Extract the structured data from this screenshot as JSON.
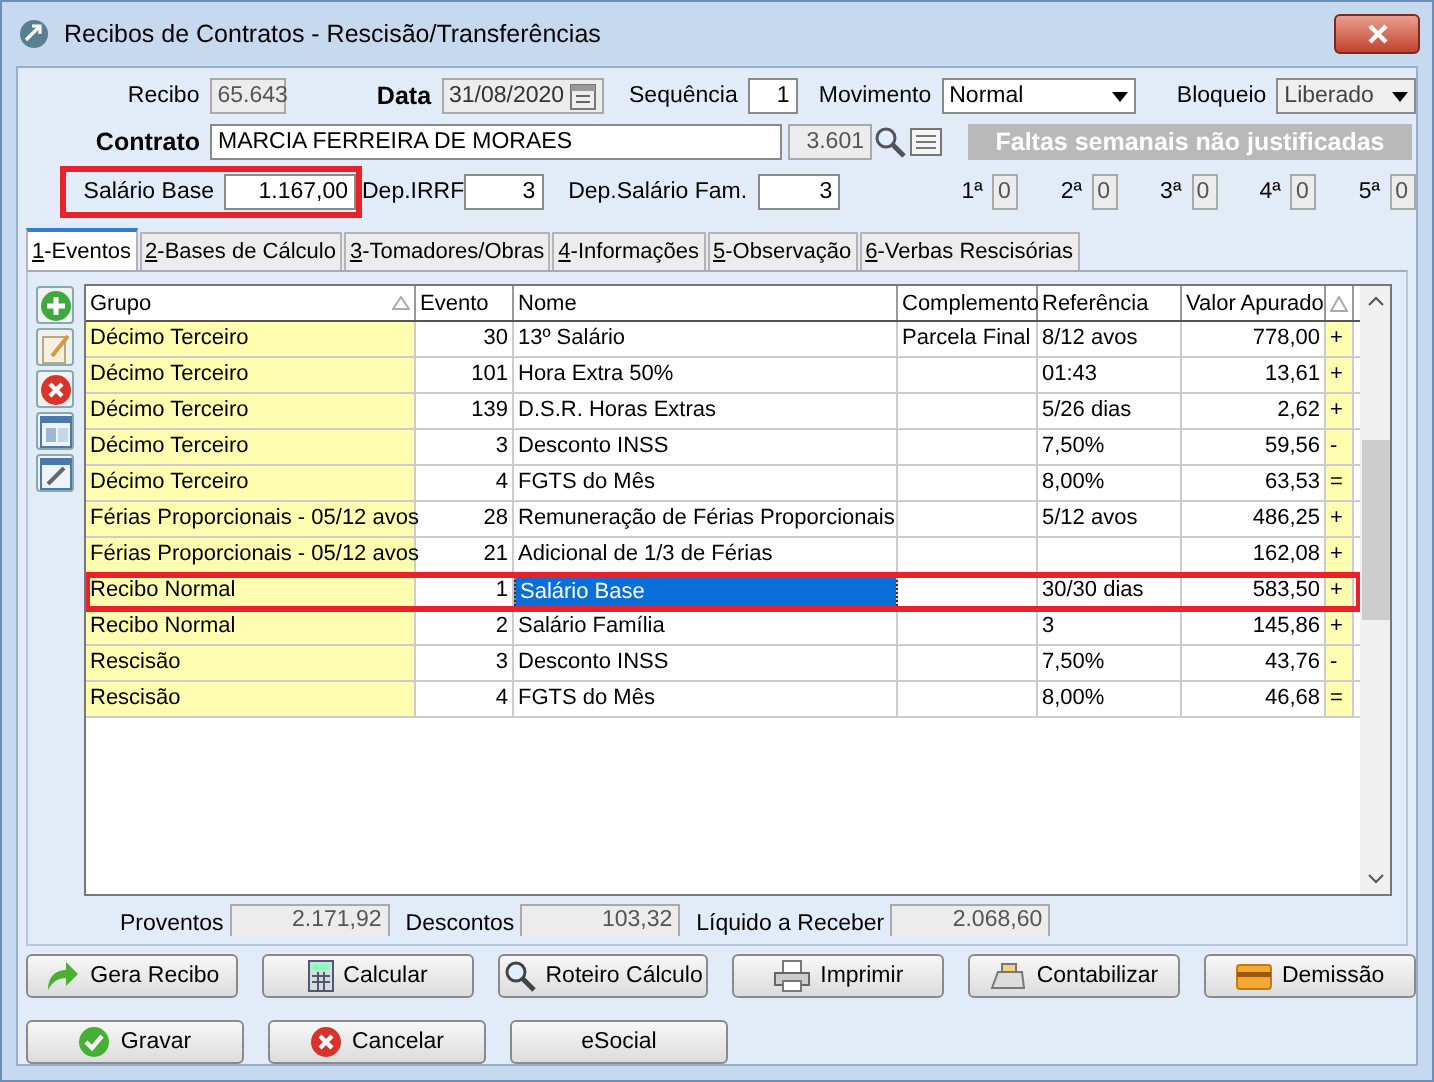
{
  "window": {
    "title": "Recibos de Contratos - Rescisão/Transferências"
  },
  "header": {
    "recibo": {
      "label": "Recibo",
      "value": "65.643"
    },
    "data": {
      "label": "Data",
      "value": "31/08/2020"
    },
    "sequencia": {
      "label": "Sequência",
      "value": "1"
    },
    "movimento": {
      "label": "Movimento",
      "value": "Normal"
    },
    "bloqueio": {
      "label": "Bloqueio",
      "value": "Liberado"
    },
    "contrato": {
      "label": "Contrato",
      "name": "MARCIA FERREIRA DE MORAES",
      "code": "3.601"
    },
    "banner": "Faltas semanais não justificadas",
    "salario_base": {
      "label": "Salário Base",
      "value": "1.167,00",
      "highlighted": true
    },
    "dep_irrf": {
      "label": "Dep.IRRF",
      "value": "3"
    },
    "dep_salario_fam": {
      "label": "Dep.Salário Fam.",
      "value": "3"
    },
    "faltas": [
      {
        "label": "1ª",
        "value": "0"
      },
      {
        "label": "2ª",
        "value": "0"
      },
      {
        "label": "3ª",
        "value": "0"
      },
      {
        "label": "4ª",
        "value": "0"
      },
      {
        "label": "5ª",
        "value": "0"
      }
    ]
  },
  "tabs": [
    {
      "label": "1-Eventos",
      "selected": true
    },
    {
      "label": "2-Bases de Cálculo",
      "selected": false
    },
    {
      "label": "3-Tomadores/Obras",
      "selected": false
    },
    {
      "label": "4-Informações",
      "selected": false
    },
    {
      "label": "5-Observação",
      "selected": false
    },
    {
      "label": "6-Verbas Rescisórias",
      "selected": false
    }
  ],
  "table": {
    "columns": [
      "Grupo",
      "Evento",
      "Nome",
      "Complemento",
      "Referência",
      "Valor Apurado"
    ],
    "rows": [
      {
        "grupo": "Décimo Terceiro",
        "evento": "30",
        "nome": "13º Salário",
        "complemento": "Parcela Final",
        "referencia": "8/12 avos",
        "valor": "778,00",
        "sinal": "+",
        "selected": false,
        "highlighted": false
      },
      {
        "grupo": "Décimo Terceiro",
        "evento": "101",
        "nome": "Hora Extra 50%",
        "complemento": "",
        "referencia": "01:43",
        "valor": "13,61",
        "sinal": "+",
        "selected": false,
        "highlighted": false
      },
      {
        "grupo": "Décimo Terceiro",
        "evento": "139",
        "nome": "D.S.R. Horas Extras",
        "complemento": "",
        "referencia": "5/26 dias",
        "valor": "2,62",
        "sinal": "+",
        "selected": false,
        "highlighted": false
      },
      {
        "grupo": "Décimo Terceiro",
        "evento": "3",
        "nome": "Desconto INSS",
        "complemento": "",
        "referencia": "7,50%",
        "valor": "59,56",
        "sinal": "-",
        "selected": false,
        "highlighted": false
      },
      {
        "grupo": "Décimo Terceiro",
        "evento": "4",
        "nome": "FGTS do Mês",
        "complemento": "",
        "referencia": "8,00%",
        "valor": "63,53",
        "sinal": "=",
        "selected": false,
        "highlighted": false
      },
      {
        "grupo": "Férias Proporcionais - 05/12 avos",
        "evento": "28",
        "nome": "Remuneração de Férias Proporcionais",
        "complemento": "",
        "referencia": "5/12 avos",
        "valor": "486,25",
        "sinal": "+",
        "selected": false,
        "highlighted": false
      },
      {
        "grupo": "Férias Proporcionais - 05/12 avos",
        "evento": "21",
        "nome": "Adicional de 1/3 de Férias",
        "complemento": "",
        "referencia": "",
        "valor": "162,08",
        "sinal": "+",
        "selected": false,
        "highlighted": false
      },
      {
        "grupo": "Recibo Normal",
        "evento": "1",
        "nome": "Salário Base",
        "complemento": "",
        "referencia": "30/30 dias",
        "valor": "583,50",
        "sinal": "+",
        "selected": true,
        "highlighted": true
      },
      {
        "grupo": "Recibo Normal",
        "evento": "2",
        "nome": "Salário Família",
        "complemento": "",
        "referencia": "3",
        "valor": "145,86",
        "sinal": "+",
        "selected": false,
        "highlighted": false
      },
      {
        "grupo": "Rescisão",
        "evento": "3",
        "nome": "Desconto INSS",
        "complemento": "",
        "referencia": "7,50%",
        "valor": "43,76",
        "sinal": "-",
        "selected": false,
        "highlighted": false
      },
      {
        "grupo": "Rescisão",
        "evento": "4",
        "nome": "FGTS do Mês",
        "complemento": "",
        "referencia": "8,00%",
        "valor": "46,68",
        "sinal": "=",
        "selected": false,
        "highlighted": false
      }
    ]
  },
  "totals": [
    {
      "label": "Proventos",
      "value": "2.171,92"
    },
    {
      "label": "Descontos",
      "value": "103,32"
    },
    {
      "label": "Líquido a Receber",
      "value": "2.068,60"
    }
  ],
  "buttons": [
    {
      "label": "Gera Recibo",
      "kind": "arrow"
    },
    {
      "label": "Calcular",
      "kind": "calculator"
    },
    {
      "label": "Roteiro Cálculo",
      "kind": "magnifier"
    },
    {
      "label": "Imprimir",
      "kind": "printer"
    },
    {
      "label": "Contabilizar",
      "kind": "register"
    },
    {
      "label": "Demissão",
      "kind": "card"
    }
  ],
  "actions": [
    {
      "label": "Gravar",
      "kind": "check"
    },
    {
      "label": "Cancelar",
      "kind": "cancel"
    },
    {
      "label": "eSocial",
      "kind": "none"
    }
  ]
}
